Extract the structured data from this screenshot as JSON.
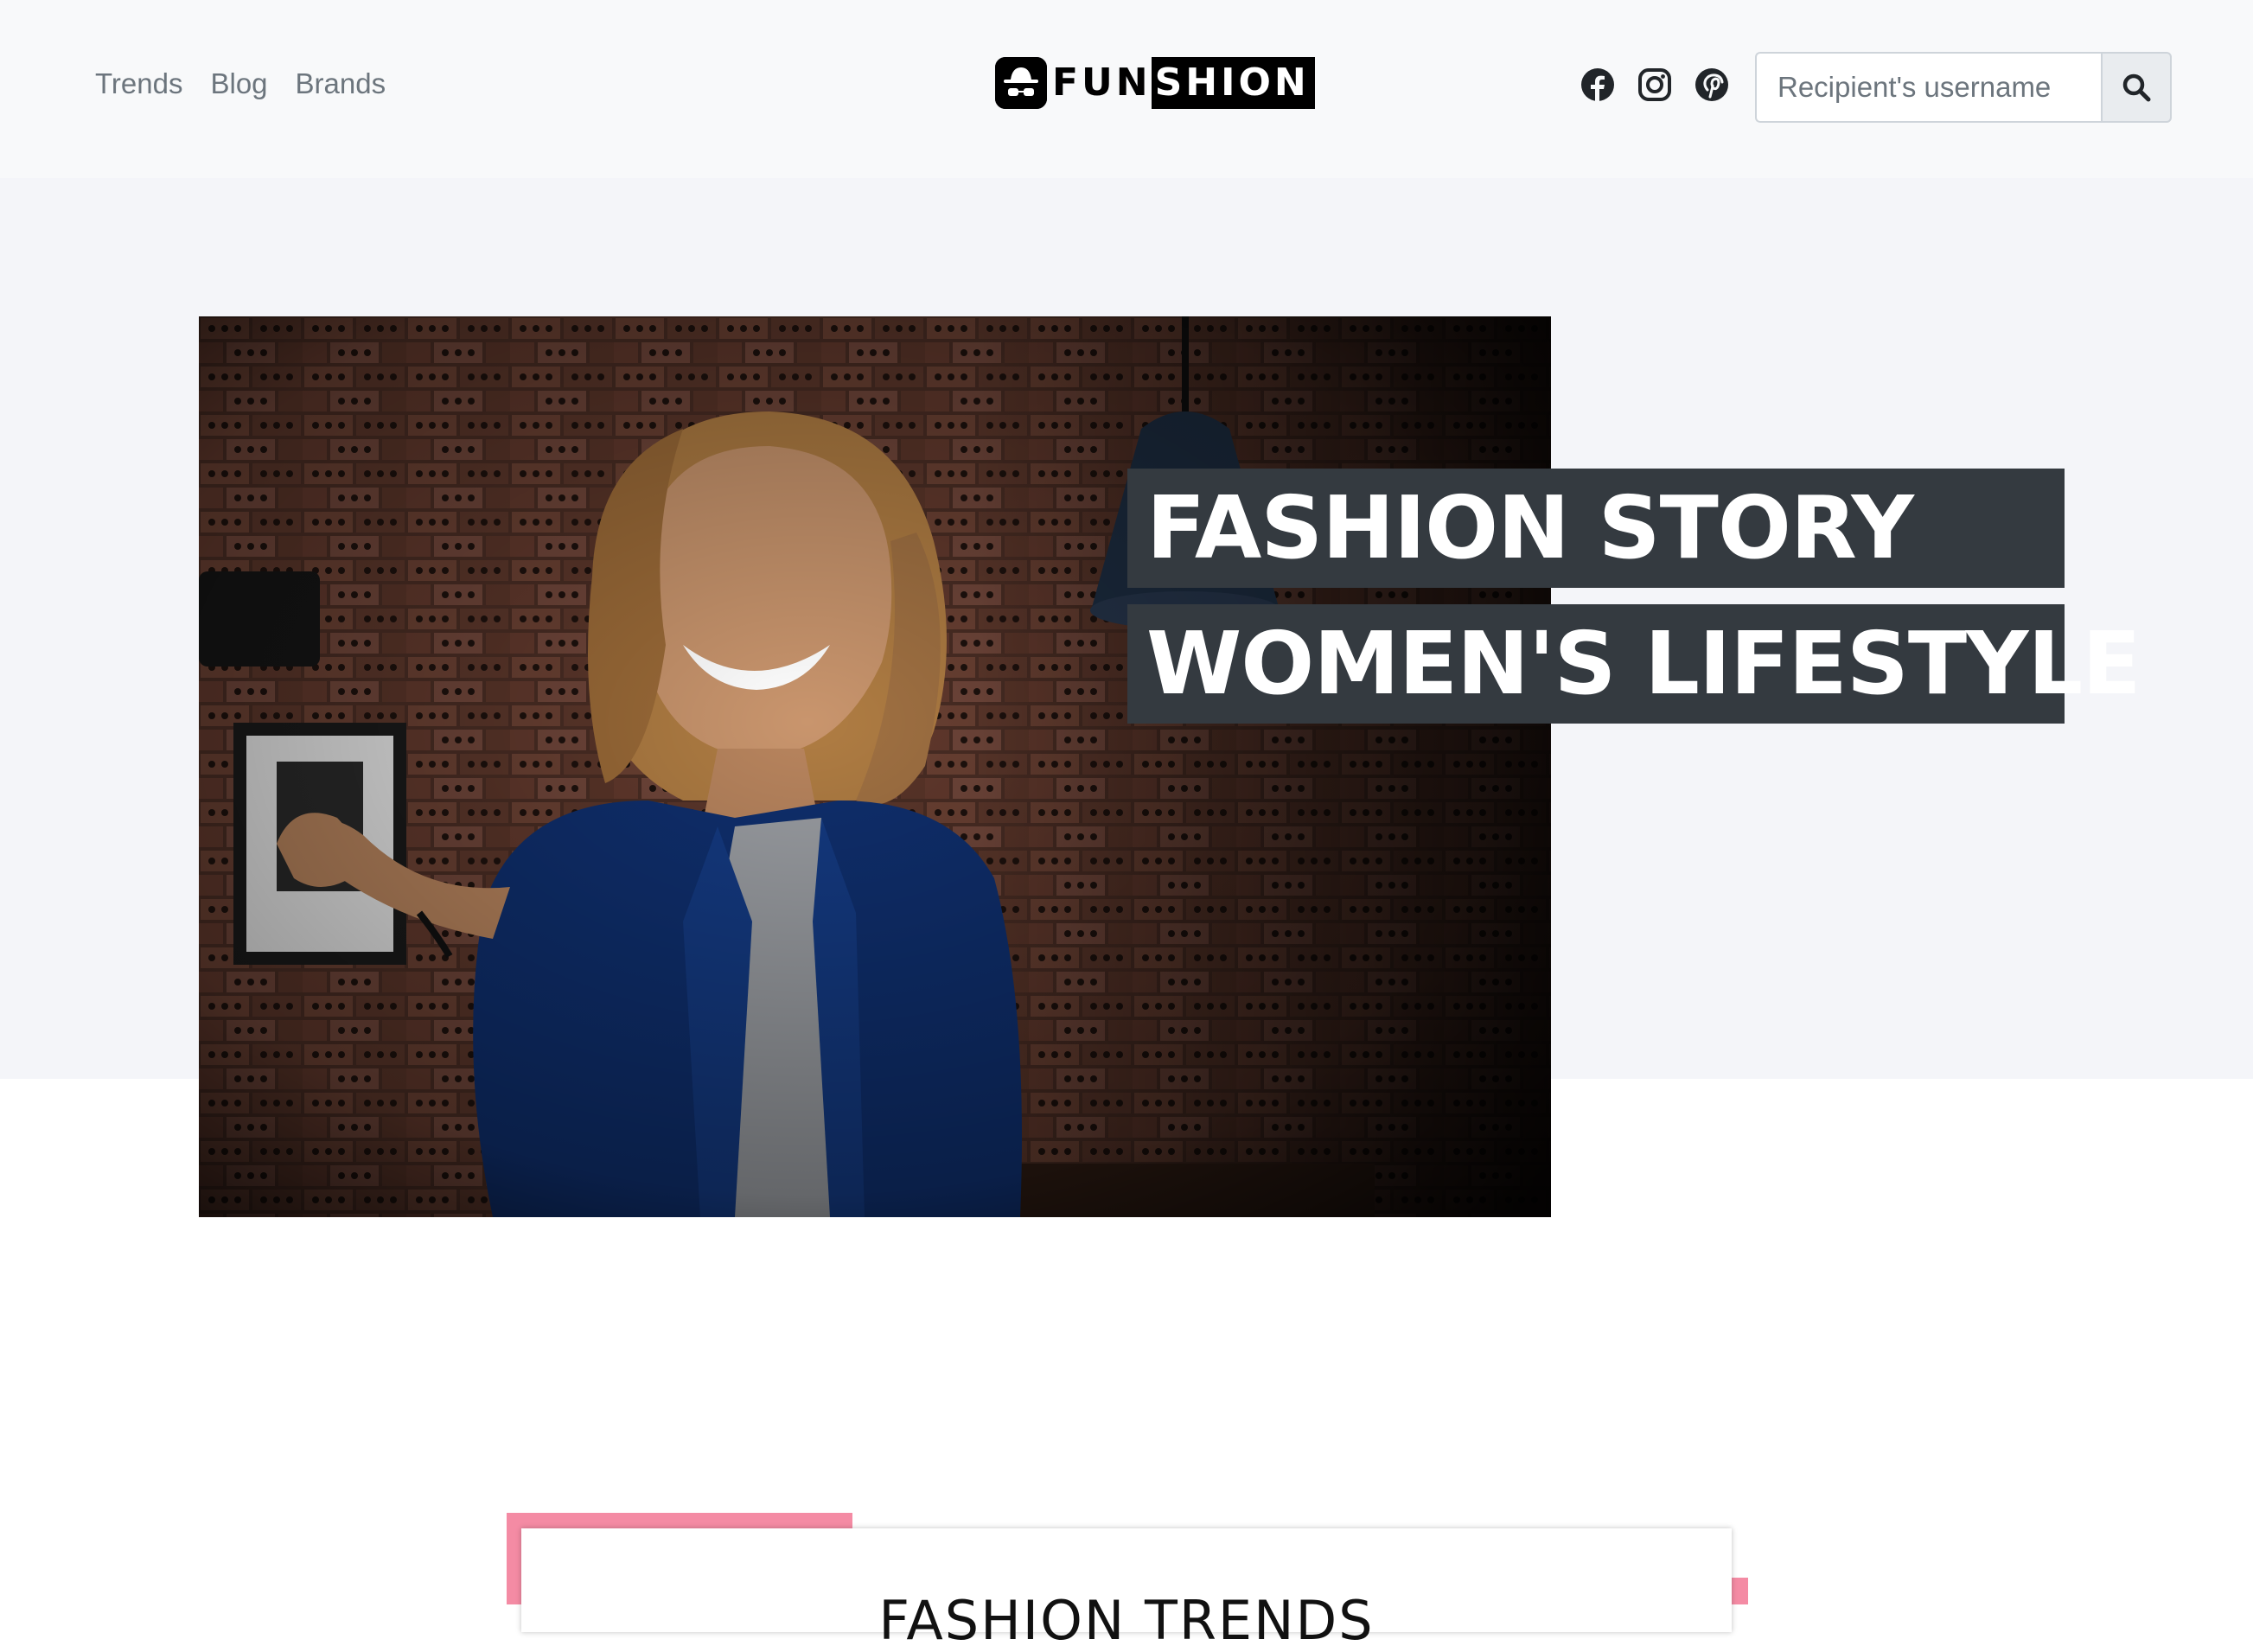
{
  "navbar": {
    "links": [
      "Trends",
      "Blog",
      "Brands"
    ],
    "brand": {
      "part1": "FUN",
      "part2": "SHION"
    },
    "social": [
      "facebook-icon",
      "instagram-icon",
      "pinterest-icon"
    ],
    "search": {
      "placeholder": "Recipient's username",
      "button_icon": "search-icon"
    }
  },
  "hero": {
    "title_line1": "FASHION STORY",
    "title_line2": "WOMEN'S LIFESTYLE"
  },
  "trends": {
    "title": "FASHION TRENDS"
  },
  "colors": {
    "accent_pink": "#f48ba4",
    "title_bg": "#343a40",
    "navbar_bg": "#f8f9fa"
  }
}
